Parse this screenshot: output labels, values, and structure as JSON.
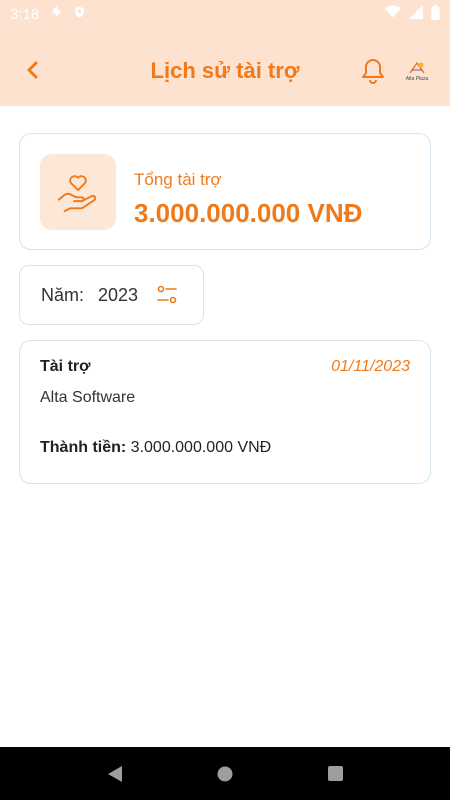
{
  "status_bar": {
    "time": "3:18"
  },
  "header": {
    "title": "Lịch sử tài trợ",
    "logo_text": "Alta Plaza"
  },
  "summary": {
    "label": "Tổng tài trợ",
    "value": "3.000.000.000 VNĐ"
  },
  "filter": {
    "label": "Năm:",
    "year": "2023"
  },
  "records": [
    {
      "type": "Tài trợ",
      "date": "01/11/2023",
      "sponsor": "Alta Software",
      "amount_label": "Thành tiền:",
      "amount_value": "3.000.000.000 VNĐ"
    }
  ],
  "colors": {
    "accent": "#f07a1a",
    "header_bg": "#fde2cf",
    "border": "#d6e4ee"
  },
  "icons": [
    "settings-icon",
    "shield-icon",
    "wifi-icon",
    "signal-icon",
    "battery-icon",
    "back-icon",
    "bell-icon",
    "heart-hand-icon",
    "filter-icon",
    "nav-back-icon",
    "nav-home-icon",
    "nav-recents-icon"
  ]
}
